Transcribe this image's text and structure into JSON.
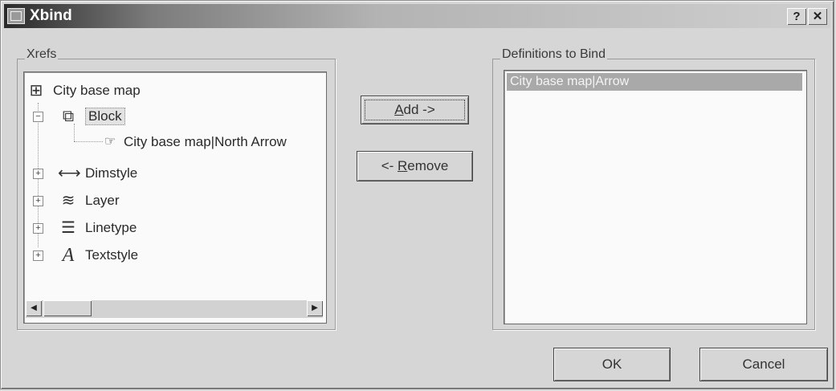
{
  "window": {
    "title": "Xbind",
    "help_label": "?",
    "close_label": "✕"
  },
  "xrefs": {
    "label": "Xrefs",
    "root": {
      "icon": "xref-icon",
      "label": "City base map"
    },
    "nodes": [
      {
        "expander": "−",
        "icon": "block-icon",
        "label": "Block",
        "expanded": true,
        "selected": true
      },
      {
        "icon": "pointing-hand-icon",
        "label": "City base map|North Arrow",
        "child": true
      },
      {
        "expander": "+",
        "icon": "dimstyle-icon",
        "label": "Dimstyle"
      },
      {
        "expander": "+",
        "icon": "layer-icon",
        "label": "Layer"
      },
      {
        "expander": "+",
        "icon": "linetype-icon",
        "label": "Linetype"
      },
      {
        "expander": "+",
        "icon": "textstyle-icon",
        "label": "Textstyle"
      }
    ],
    "scroll_left": "◀",
    "scroll_right": "▶"
  },
  "buttons": {
    "add_prefix": "",
    "add_accel": "A",
    "add_rest": "dd ->",
    "remove_prefix": "<- ",
    "remove_accel": "R",
    "remove_rest": "emove",
    "ok": "OK",
    "cancel": "Cancel"
  },
  "definitions": {
    "label": "Definitions to Bind",
    "items": [
      "City base map|Arrow"
    ]
  }
}
